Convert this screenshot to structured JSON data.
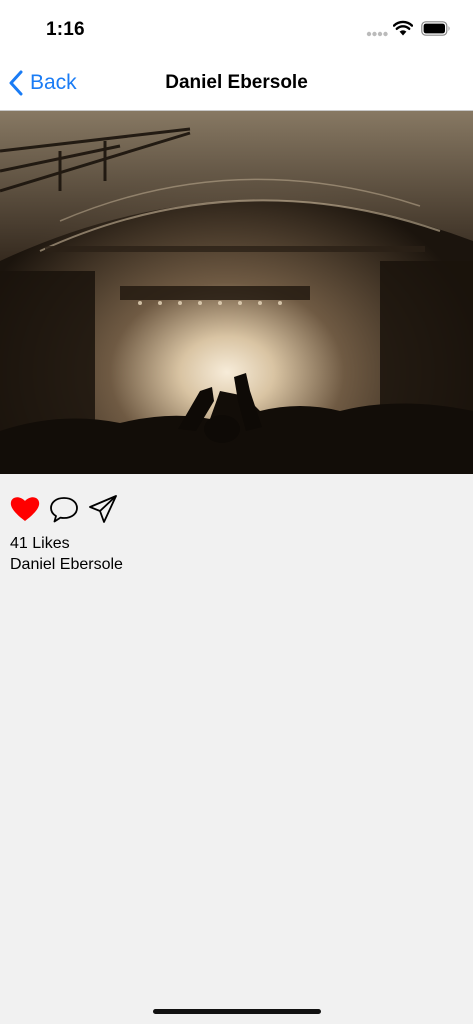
{
  "status_bar": {
    "time": "1:16"
  },
  "nav": {
    "back_label": "Back",
    "title": "Daniel Ebersole"
  },
  "post": {
    "photo_description_icon": "concert-photo",
    "likes_text": "41 Likes",
    "author": "Daniel Ebersole",
    "liked": true
  },
  "icons": {
    "like": "heart-icon",
    "comment": "comment-bubble-icon",
    "share": "paper-plane-icon"
  },
  "colors": {
    "accent": "#1a7cf5",
    "heart": "#ff0000",
    "background": "#f1f1f1"
  }
}
